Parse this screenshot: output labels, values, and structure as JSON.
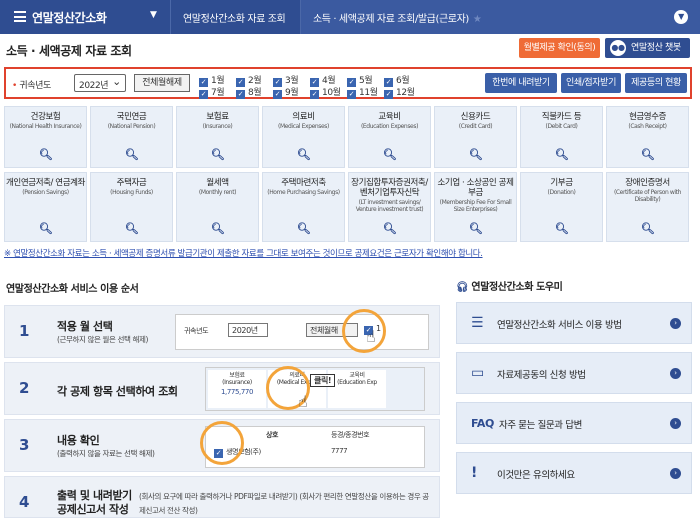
{
  "header": {
    "title": "연말정산간소화",
    "tab_main": "연말정산간소화 자료 조회",
    "tab_active": "소득 · 세액공제 자료 조회/발급(근로자)"
  },
  "page": {
    "title": "소득 · 세액공제 자료 조회",
    "monthly_btn": "월별제공 확인(동의)",
    "chatbot_btn": "연말정산 챗봇"
  },
  "filter": {
    "label": "귀속년도",
    "year": "2022년",
    "clear_btn": "전체월해제",
    "months": [
      "1월",
      "2월",
      "3월",
      "4월",
      "5월",
      "6월",
      "7월",
      "8월",
      "9월",
      "10월",
      "11월",
      "12월"
    ],
    "download_btn": "한번에 내려받기",
    "print_btn": "인쇄/점자받기",
    "provider_btn": "제공등의 현황"
  },
  "categories": [
    {
      "title": "건강보험",
      "sub": "(National Health Insurance)"
    },
    {
      "title": "국민연금",
      "sub": "(National Pension)"
    },
    {
      "title": "보험료",
      "sub": "(Insurance)"
    },
    {
      "title": "의료비",
      "sub": "(Medical Expenses)"
    },
    {
      "title": "교육비",
      "sub": "(Education Expenses)"
    },
    {
      "title": "신용카드",
      "sub": "(Credit Card)"
    },
    {
      "title": "직불카드 등",
      "sub": "(Debit Card)"
    },
    {
      "title": "현금영수증",
      "sub": "(Cash Receipt)"
    },
    {
      "title": "개인연금저축/ 연금계좌",
      "sub": "(Pension Savings)"
    },
    {
      "title": "주택자금",
      "sub": "(Housing Funds)"
    },
    {
      "title": "월세액",
      "sub": "(Monthly rent)"
    },
    {
      "title": "주택마련저축",
      "sub": "(Home Purchasing Savings)"
    },
    {
      "title": "장기집합투자증권저축/ 벤처기업투자신탁",
      "sub": "(LT investment savings/ Venture investment trust)"
    },
    {
      "title": "소기업 · 소상공인 공제부금",
      "sub": "(Membership Fee For Small Size Enterprises)"
    },
    {
      "title": "기부금",
      "sub": "(Donation)"
    },
    {
      "title": "장애인증명서",
      "sub": "(Certificate of Person with Disability)"
    }
  ],
  "notice": "※ 연말정산간소화 자료는 소득 · 세액공제 증명서류 발급기관이 제출한 자료를 그대로 보여주는 것이므로 공제요건은 근로자가 확인해야 합니다.",
  "steps_title": "연말정산간소화 서비스 이용 순서",
  "steps": [
    {
      "num": "1",
      "title": "적용 월 선택",
      "sub": "(근무하지 않은 월은 선택 해제)"
    },
    {
      "num": "2",
      "title": "각 공제 항목 선택하여 조회",
      "sub": ""
    },
    {
      "num": "3",
      "title": "내용 확인",
      "sub": "(출력하지 않을 자료는 선택 해제)"
    },
    {
      "num": "4",
      "title": "출력 및 내려받기 공제신고서 작성",
      "sub": "(회사의 요구에 따라 출력하거나 PDF파일로 내려받기) (회사가 편리한 연말정산을 이용하는 경우 공제신고서 전산 작성)"
    }
  ],
  "step_shots": {
    "s1_label": "귀속년도",
    "s1_year": "2020년",
    "s1_btn": "전체월해",
    "s1_m1": "1",
    "s2_c1": "보험료",
    "s2_c1s": "(Insurance)",
    "s2_c1v": "1,775,770",
    "s2_c2": "의료비",
    "s2_c2s": "(Medical Expen",
    "s2_click": "클릭!",
    "s2_c3": "교육비",
    "s2_c3s": "(Education Exp",
    "s3_h1": "상호",
    "s3_h2": "등경/종경번호",
    "s3_row": "생명보험(주)",
    "s3_num": "7777"
  },
  "help_title": "연말정산간소화 도우미",
  "help_items": [
    {
      "icon": "document-list-icon",
      "label": "연말정산간소화 서비스 이용 방법"
    },
    {
      "icon": "form-icon",
      "label": "자료제공동의 신청 방법"
    },
    {
      "icon": "faq-icon",
      "label": "자주 묻는 질문과 답변"
    },
    {
      "icon": "alert-icon",
      "label": "이것만은 유의하세요"
    }
  ]
}
